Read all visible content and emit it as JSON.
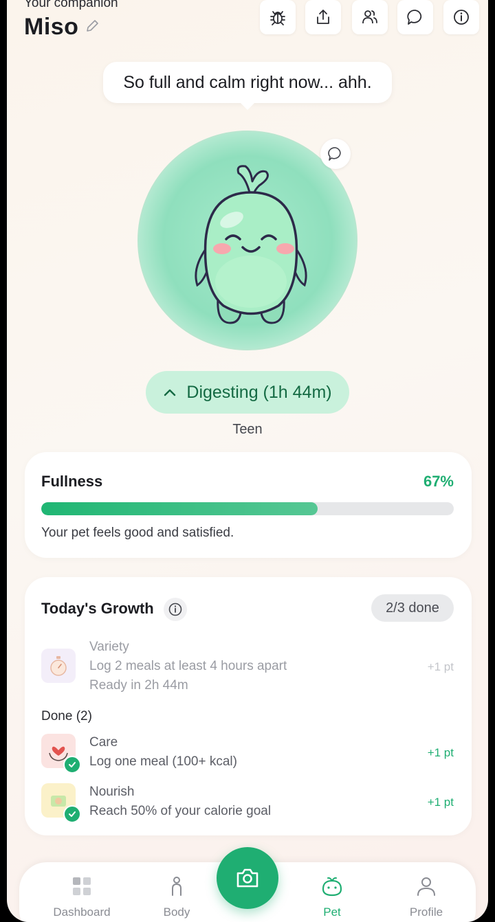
{
  "header": {
    "subtitle": "Your companion",
    "pet_name": "Miso",
    "buttons": [
      "bug-icon",
      "share-icon",
      "friends-icon",
      "chat-icon",
      "info-icon"
    ]
  },
  "speech_bubble": "So full and calm right now... ahh.",
  "status": {
    "label": "Digesting (1h 44m)",
    "stage": "Teen"
  },
  "fullness": {
    "title": "Fullness",
    "percent_label": "67%",
    "percent": 67,
    "message": "Your pet feels good and satisfied."
  },
  "growth": {
    "title": "Today's Growth",
    "badge": "2/3 done",
    "pending": {
      "name": "Variety",
      "desc": "Log 2 meals at least 4 hours apart",
      "eta": "Ready in 2h 44m",
      "points": "+1 pt"
    },
    "done_label": "Done (2)",
    "done": [
      {
        "name": "Care",
        "desc": "Log one meal (100+ kcal)",
        "points": "+1 pt"
      },
      {
        "name": "Nourish",
        "desc": "Reach 50% of your calorie goal",
        "points": "+1 pt"
      }
    ]
  },
  "tabs": [
    {
      "label": "Dashboard",
      "icon": "dashboard-icon"
    },
    {
      "label": "Body",
      "icon": "body-icon"
    },
    {
      "label": "Pet",
      "icon": "pet-icon",
      "active": true
    },
    {
      "label": "Profile",
      "icon": "profile-icon"
    }
  ],
  "colors": {
    "accent": "#1fae72",
    "pet_body": "#9fe6c2",
    "pill_bg": "#c9f1dc"
  }
}
